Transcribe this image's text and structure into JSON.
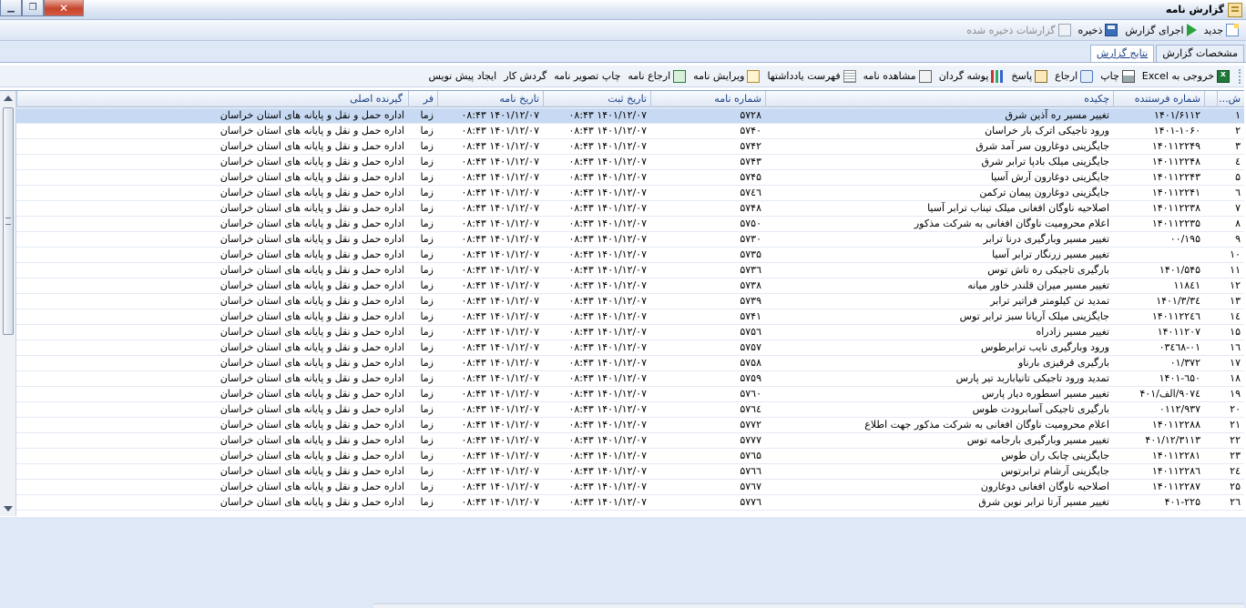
{
  "window": {
    "title": "گزارش نامه"
  },
  "menu": {
    "new": "جدید",
    "run": "اجرای گزارش",
    "save": "ذخیره",
    "saved": "گزارشات ذخیره شده"
  },
  "tabs": [
    "مشخصات گزارش",
    "نتایج گزارش"
  ],
  "toolbar": {
    "excel": "خروجی به Excel",
    "print": "چاپ",
    "return": "ارجاع",
    "reply": "پاسخ",
    "folder": "پوشه گردان",
    "view": "مشاهده نامه",
    "notes": "فهرست یادداشتها",
    "edit": "ویرایش نامه",
    "return_letter": "ارجاع نامه",
    "print_image": "چاپ تصویر نامه",
    "workflow": "گردش کار",
    "draft": "ایجاد پیش نویس"
  },
  "grid": {
    "headers": {
      "rownum": "ش...",
      "sender_no": "شماره فرستنده",
      "summary": "چکیده",
      "letter_no": "شماره نامه",
      "reg_date": "تاریخ ثبت",
      "letter_date": "تاریخ نامه",
      "fr": "فر",
      "receiver": "گیرنده اصلی"
    },
    "rows": [
      {
        "n": "۱",
        "sender": "۱۴۰۱/۶۱۱۲",
        "summary": "تغییر مسیر ره آذین شرق",
        "no": "۵۷۲۸",
        "reg": "۰۸:۴۳ ۱۴۰۱/۱۲/۰۷",
        "date": "۰۸:۴۳ ۱۴۰۱/۱۲/۰۷",
        "fr": "زما",
        "rcv": "اداره حمل و نقل و پایانه های استان خراسان"
      },
      {
        "n": "۲",
        "sender": "۱۴۰۱-۱۰۶۰",
        "summary": "ورود تاجیکی اترک بار خراسان",
        "no": "۵۷۴۰",
        "reg": "۰۸:۴۳ ۱۴۰۱/۱۲/۰۷",
        "date": "۰۸:۴۳ ۱۴۰۱/۱۲/۰۷",
        "fr": "زما",
        "rcv": "اداره حمل و نقل و پایانه های استان خراسان"
      },
      {
        "n": "۳",
        "sender": "۱۴۰۱۱۲۲۴۹",
        "summary": "جایگزینی دوغارون سر آمد شرق",
        "no": "۵۷۴۲",
        "reg": "۰۸:۴۳ ۱۴۰۱/۱۲/۰۷",
        "date": "۰۸:۴۳ ۱۴۰۱/۱۲/۰۷",
        "fr": "زما",
        "rcv": "اداره حمل و نقل و پایانه های استان خراسان"
      },
      {
        "n": "٤",
        "sender": "۱۴۰۱۱۲۲۴۸",
        "summary": "جایگزینی میلک بادپا ترابر شرق",
        "no": "۵۷۴۳",
        "reg": "۰۸:۴۳ ۱۴۰۱/۱۲/۰۷",
        "date": "۰۸:۴۳ ۱۴۰۱/۱۲/۰۷",
        "fr": "زما",
        "rcv": "اداره حمل و نقل و پایانه های استان خراسان"
      },
      {
        "n": "۵",
        "sender": "۱۴۰۱۱۲۲۴۳",
        "summary": "جایگزینی دوغارون آرش آسیا",
        "no": "۵۷۴۵",
        "reg": "۰۸:۴۳ ۱۴۰۱/۱۲/۰۷",
        "date": "۰۸:۴۳ ۱۴۰۱/۱۲/۰۷",
        "fr": "زما",
        "rcv": "اداره حمل و نقل و پایانه های استان خراسان"
      },
      {
        "n": "٦",
        "sender": "۱۴۰۱۱۲۲۴۱",
        "summary": "جایگزینی دوغارون پیمان ترکمن",
        "no": "۵۷٤٦",
        "reg": "۰۸:۴۳ ۱۴۰۱/۱۲/۰۷",
        "date": "۰۸:۴۳ ۱۴۰۱/۱۲/۰۷",
        "fr": "زما",
        "rcv": "اداره حمل و نقل و پایانه های استان خراسان"
      },
      {
        "n": "۷",
        "sender": "۱۴۰۱۱۲۲۳۸",
        "summary": "اصلاحیه ناوگان افغانی میلک تیناب ترابر آسیا",
        "no": "۵۷۴۸",
        "reg": "۰۸:۴۳ ۱۴۰۱/۱۲/۰۷",
        "date": "۰۸:۴۳ ۱۴۰۱/۱۲/۰۷",
        "fr": "زما",
        "rcv": "اداره حمل و نقل و پایانه های استان خراسان"
      },
      {
        "n": "۸",
        "sender": "۱۴۰۱۱۲۲۳۵",
        "summary": "اعلام محرومیت ناوگان افغانی به شرکت مذکور",
        "no": "۵۷۵۰",
        "reg": "۰۸:۴۳ ۱۴۰۱/۱۲/۰۷",
        "date": "۰۸:۴۳ ۱۴۰۱/۱۲/۰۷",
        "fr": "زما",
        "rcv": "اداره حمل و نقل و پایانه های استان خراسان"
      },
      {
        "n": "۹",
        "sender": "۰۰/۱۹۵",
        "summary": "تغییر مسیر وبارگیری درنا ترابر",
        "no": "۵۷۳۰",
        "reg": "۰۸:۴۳ ۱۴۰۱/۱۲/۰۷",
        "date": "۰۸:۴۳ ۱۴۰۱/۱۲/۰۷",
        "fr": "زما",
        "rcv": "اداره حمل و نقل و پایانه های استان خراسان"
      },
      {
        "n": "۱۰",
        "sender": "",
        "summary": "تغییر مسیر زرنگار ترابر آسیا",
        "no": "۵۷۳۵",
        "reg": "۰۸:۴۳ ۱۴۰۱/۱۲/۰۷",
        "date": "۰۸:۴۳ ۱۴۰۱/۱۲/۰۷",
        "fr": "زما",
        "rcv": "اداره حمل و نقل و پایانه های استان خراسان"
      },
      {
        "n": "۱۱",
        "sender": "۱۴۰۱/۵۴۵",
        "summary": "بارگیری تاجیکی ره تاش توس",
        "no": "۵۷۳٦",
        "reg": "۰۸:۴۳ ۱۴۰۱/۱۲/۰۷",
        "date": "۰۸:۴۳ ۱۴۰۱/۱۲/۰۷",
        "fr": "زما",
        "rcv": "اداره حمل و نقل و پایانه های استان خراسان"
      },
      {
        "n": "۱۲",
        "sender": "۱۱۸٤۱",
        "summary": "تغییر مسیر میران قلندر خاور میانه",
        "no": "۵۷۳۸",
        "reg": "۰۸:۴۳ ۱۴۰۱/۱۲/۰۷",
        "date": "۰۸:۴۳ ۱۴۰۱/۱۲/۰۷",
        "fr": "زما",
        "rcv": "اداره حمل و نقل و پایانه های استان خراسان"
      },
      {
        "n": "۱۳",
        "sender": "۱۴۰۱/۳/۳٤",
        "summary": "تمدید تن کیلومتر فراتیر ترابر",
        "no": "۵۷۳۹",
        "reg": "۰۸:۴۳ ۱۴۰۱/۱۲/۰۷",
        "date": "۰۸:۴۳ ۱۴۰۱/۱۲/۰۷",
        "fr": "زما",
        "rcv": "اداره حمل و نقل و پایانه های استان خراسان"
      },
      {
        "n": "۱٤",
        "sender": "۱۴۰۱۱۲۲٤٦",
        "summary": "جایگزینی میلک آریانا سبز ترابر توس",
        "no": "۵۷۴۱",
        "reg": "۰۸:۴۳ ۱۴۰۱/۱۲/۰۷",
        "date": "۰۸:۴۳ ۱۴۰۱/۱۲/۰۷",
        "fr": "زما",
        "rcv": "اداره حمل و نقل و پایانه های استان خراسان"
      },
      {
        "n": "۱۵",
        "sender": "۱۴۰۱۱۲۰۷",
        "summary": "تغییر مسیر زادراه",
        "no": "۵۷۵٦",
        "reg": "۰۸:۴۳ ۱۴۰۱/۱۲/۰۷",
        "date": "۰۸:۴۳ ۱۴۰۱/۱۲/۰۷",
        "fr": "زما",
        "rcv": "اداره حمل و نقل و پایانه های استان خراسان"
      },
      {
        "n": "۱٦",
        "sender": "۰۳٤٦۸-۰۱",
        "summary": "ورود وبارگیری نایب ترابرطوس",
        "no": "۵۷۵۷",
        "reg": "۰۸:۴۳ ۱۴۰۱/۱۲/۰۷",
        "date": "۰۸:۴۳ ۱۴۰۱/۱۲/۰۷",
        "fr": "زما",
        "rcv": "اداره حمل و نقل و پایانه های استان خراسان"
      },
      {
        "n": "۱۷",
        "sender": "۰۱/۳۷۲",
        "summary": "بارگیری قرقیزی بارناو",
        "no": "۵۷۵۸",
        "reg": "۰۸:۴۳ ۱۴۰۱/۱۲/۰۷",
        "date": "۰۸:۴۳ ۱۴۰۱/۱۲/۰۷",
        "fr": "زما",
        "rcv": "اداره حمل و نقل و پایانه های استان خراسان"
      },
      {
        "n": "۱۸",
        "sender": "۱۴۰۱-٦۵۰",
        "summary": "تمدید ورود تاجیکی تانیاباربد تیر پارس",
        "no": "۵۷۵۹",
        "reg": "۰۸:۴۳ ۱۴۰۱/۱۲/۰۷",
        "date": "۰۸:۴۳ ۱۴۰۱/۱۲/۰۷",
        "fr": "زما",
        "rcv": "اداره حمل و نقل و پایانه های استان خراسان"
      },
      {
        "n": "۱۹",
        "sender": "۹۰۷٤/الف/۴۰۱",
        "summary": "تغییر مسیر اسطوره دیار پارس",
        "no": "۵۷٦۰",
        "reg": "۰۸:۴۳ ۱۴۰۱/۱۲/۰۷",
        "date": "۰۸:۴۳ ۱۴۰۱/۱۲/۰۷",
        "fr": "زما",
        "rcv": "اداره حمل و نقل و پایانه های استان خراسان"
      },
      {
        "n": "۲۰",
        "sender": "۰۱۱۲/۹۳۷",
        "summary": "بارگیری تاجیکی آسابرودت طوس",
        "no": "۵۷٦٤",
        "reg": "۰۸:۴۳ ۱۴۰۱/۱۲/۰۷",
        "date": "۰۸:۴۳ ۱۴۰۱/۱۲/۰۷",
        "fr": "زما",
        "rcv": "اداره حمل و نقل و پایانه های استان خراسان"
      },
      {
        "n": "۲۱",
        "sender": "۱۴۰۱۱۲۲۸۸",
        "summary": "اعلام محرومیت ناوگان افغانی به شرکت مذکور جهت اطلاع",
        "no": "۵۷۷۲",
        "reg": "۰۸:۴۳ ۱۴۰۱/۱۲/۰۷",
        "date": "۰۸:۴۳ ۱۴۰۱/۱۲/۰۷",
        "fr": "زما",
        "rcv": "اداره حمل و نقل و پایانه های استان خراسان"
      },
      {
        "n": "۲۲",
        "sender": "۴۰۱/۱۲/۳۱۱۳",
        "summary": "تغییر مسیر وبارگیری بارجامه توس",
        "no": "۵۷۷۷",
        "reg": "۰۸:۴۳ ۱۴۰۱/۱۲/۰۷",
        "date": "۰۸:۴۳ ۱۴۰۱/۱۲/۰۷",
        "fr": "زما",
        "rcv": "اداره حمل و نقل و پایانه های استان خراسان"
      },
      {
        "n": "۲۳",
        "sender": "۱۴۰۱۱۲۲۸۱",
        "summary": "جایگزینی چابک ران طوس",
        "no": "۵۷٦۵",
        "reg": "۰۸:۴۳ ۱۴۰۱/۱۲/۰۷",
        "date": "۰۸:۴۳ ۱۴۰۱/۱۲/۰۷",
        "fr": "زما",
        "rcv": "اداره حمل و نقل و پایانه های استان خراسان"
      },
      {
        "n": "۲٤",
        "sender": "۱۴۰۱۱۲۲۸٦",
        "summary": "جایگزینی آرشام ترابرتوس",
        "no": "۵۷٦٦",
        "reg": "۰۸:۴۳ ۱۴۰۱/۱۲/۰۷",
        "date": "۰۸:۴۳ ۱۴۰۱/۱۲/۰۷",
        "fr": "زما",
        "rcv": "اداره حمل و نقل و پایانه های استان خراسان"
      },
      {
        "n": "۲۵",
        "sender": "۱۴۰۱۱۲۲۸۷",
        "summary": "اصلاحیه ناوگان افغانی دوغارون",
        "no": "۵۷٦۷",
        "reg": "۰۸:۴۳ ۱۴۰۱/۱۲/۰۷",
        "date": "۰۸:۴۳ ۱۴۰۱/۱۲/۰۷",
        "fr": "زما",
        "rcv": "اداره حمل و نقل و پایانه های استان خراسان"
      },
      {
        "n": "۲٦",
        "sender": "۴۰۱-۲۲۵",
        "summary": "تغییر مسیر آرتا ترابر نوین شرق",
        "no": "۵۷۷٦",
        "reg": "۰۸:۴۳ ۱۴۰۱/۱۲/۰۷",
        "date": "۰۸:۴۳ ۱۴۰۱/۱۲/۰۷",
        "fr": "زما",
        "rcv": "اداره حمل و نقل و پایانه های استان خراسان"
      }
    ]
  }
}
